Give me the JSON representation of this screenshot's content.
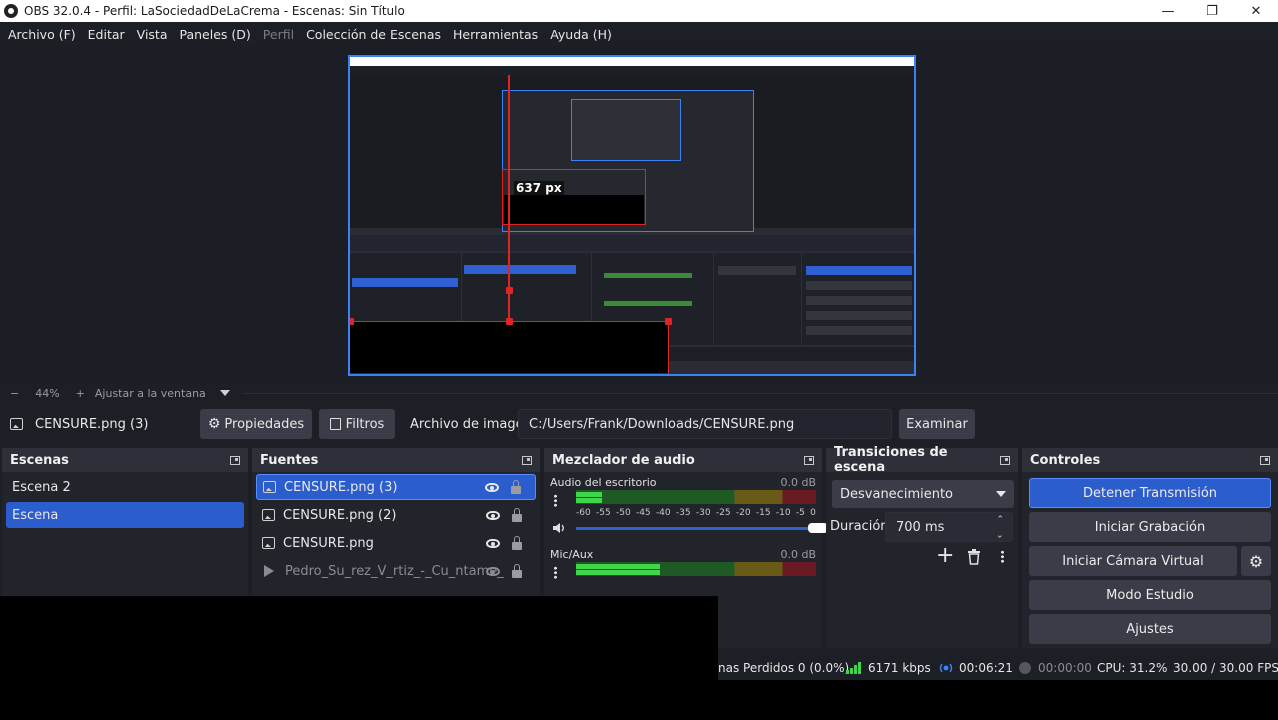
{
  "window": {
    "title": "OBS 32.0.4 - Perfil: LaSociedadDeLaCrema - Escenas: Sin Título",
    "minimize": "—",
    "maximize": "❐",
    "close": "✕"
  },
  "menu": [
    "Archivo (F)",
    "Editar",
    "Vista",
    "Paneles (D)",
    "Perfil",
    "Colección de Escenas",
    "Herramientas",
    "Ayuda (H)"
  ],
  "preview": {
    "overlay_label": "637 px",
    "zoom": "44%",
    "fit_label": "Ajustar a la ventana"
  },
  "source_toolbar": {
    "selected_source": "CENSURE.png (3)",
    "properties_label": "Propiedades",
    "filters_label": "Filtros",
    "file_label": "Archivo de imagen",
    "file_path": "C:/Users/Frank/Downloads/CENSURE.png",
    "browse_label": "Examinar"
  },
  "scenes": {
    "title": "Escenas",
    "items": [
      {
        "label": "Escena 2",
        "selected": false
      },
      {
        "label": "Escena",
        "selected": true
      }
    ]
  },
  "sources": {
    "title": "Fuentes",
    "items": [
      {
        "label": "CENSURE.png (3)",
        "type": "image",
        "visible": true,
        "selected": true
      },
      {
        "label": "CENSURE.png (2)",
        "type": "image",
        "visible": true,
        "selected": false
      },
      {
        "label": "CENSURE.png",
        "type": "image",
        "visible": true,
        "selected": false
      },
      {
        "label": "Pedro_Su_rez_V_rtiz_-_Cu_ntame_",
        "type": "media",
        "visible": false,
        "selected": false
      }
    ]
  },
  "mixer": {
    "title": "Mezclador de audio",
    "ticks": [
      "-60",
      "-55",
      "-50",
      "-45",
      "-40",
      "-35",
      "-30",
      "-25",
      "-20",
      "-15",
      "-10",
      "-5",
      "0"
    ],
    "channels": [
      {
        "name": "Audio del escritorio",
        "db": "0.0 dB",
        "level": 0.11
      },
      {
        "name": "Mic/Aux",
        "db": "0.0 dB",
        "level": 0.35
      }
    ]
  },
  "transitions": {
    "title": "Transiciones de escena",
    "selected": "Desvanecimiento",
    "duration_label": "Duración",
    "duration_value": "700 ms"
  },
  "controls": {
    "title": "Controles",
    "stop_stream": "Detener Transmisión",
    "start_recording": "Iniciar Grabación",
    "virtual_camera": "Iniciar Cámara Virtual",
    "studio_mode": "Modo Estudio",
    "settings": "Ajustes"
  },
  "status": {
    "dropped": "nas Perdidos 0 (0.0%)",
    "bitrate": "6171 kbps",
    "stream_time": "00:06:21",
    "rec_time": "00:00:00",
    "cpu": "CPU: 31.2%",
    "fps": "30.00 / 30.00 FPS"
  },
  "colors": {
    "accent": "#2c5dcd",
    "censor_outline": "#e02424",
    "canvas_outline": "#3b82f6"
  }
}
